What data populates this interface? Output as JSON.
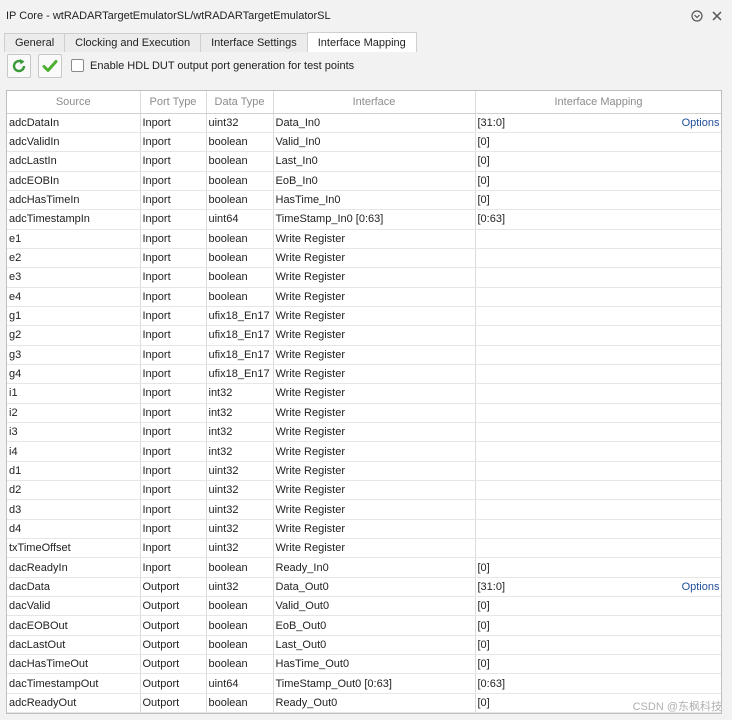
{
  "window": {
    "title": "IP Core - wtRADARTargetEmulatorSL/wtRADARTargetEmulatorSL"
  },
  "tabs": [
    {
      "label": "General"
    },
    {
      "label": "Clocking and Execution"
    },
    {
      "label": "Interface Settings"
    },
    {
      "label": "Interface Mapping"
    }
  ],
  "active_tab": "Interface Mapping",
  "toolbar": {
    "checkbox_label": "Enable HDL DUT output port generation for test points"
  },
  "table": {
    "columns": [
      "Source",
      "Port Type",
      "Data Type",
      "Interface",
      "Interface Mapping"
    ],
    "rows": [
      {
        "source": "adcDataIn",
        "port": "Inport",
        "dtype": "uint32",
        "iface": "Data_In0",
        "mapping": "[31:0]",
        "options": "Options"
      },
      {
        "source": "adcValidIn",
        "port": "Inport",
        "dtype": "boolean",
        "iface": "Valid_In0",
        "mapping": "[0]",
        "options": ""
      },
      {
        "source": "adcLastIn",
        "port": "Inport",
        "dtype": "boolean",
        "iface": "Last_In0",
        "mapping": "[0]",
        "options": ""
      },
      {
        "source": "adcEOBIn",
        "port": "Inport",
        "dtype": "boolean",
        "iface": "EoB_In0",
        "mapping": "[0]",
        "options": ""
      },
      {
        "source": "adcHasTimeIn",
        "port": "Inport",
        "dtype": "boolean",
        "iface": "HasTime_In0",
        "mapping": "[0]",
        "options": ""
      },
      {
        "source": "adcTimestampIn",
        "port": "Inport",
        "dtype": "uint64",
        "iface": "TimeStamp_In0 [0:63]",
        "mapping": "[0:63]",
        "options": ""
      },
      {
        "source": "e1",
        "port": "Inport",
        "dtype": "boolean",
        "iface": "Write Register",
        "mapping": "",
        "options": ""
      },
      {
        "source": "e2",
        "port": "Inport",
        "dtype": "boolean",
        "iface": "Write Register",
        "mapping": "",
        "options": ""
      },
      {
        "source": "e3",
        "port": "Inport",
        "dtype": "boolean",
        "iface": "Write Register",
        "mapping": "",
        "options": ""
      },
      {
        "source": "e4",
        "port": "Inport",
        "dtype": "boolean",
        "iface": "Write Register",
        "mapping": "",
        "options": ""
      },
      {
        "source": "g1",
        "port": "Inport",
        "dtype": "ufix18_En17",
        "iface": "Write Register",
        "mapping": "",
        "options": ""
      },
      {
        "source": "g2",
        "port": "Inport",
        "dtype": "ufix18_En17",
        "iface": "Write Register",
        "mapping": "",
        "options": ""
      },
      {
        "source": "g3",
        "port": "Inport",
        "dtype": "ufix18_En17",
        "iface": "Write Register",
        "mapping": "",
        "options": ""
      },
      {
        "source": "g4",
        "port": "Inport",
        "dtype": "ufix18_En17",
        "iface": "Write Register",
        "mapping": "",
        "options": ""
      },
      {
        "source": "i1",
        "port": "Inport",
        "dtype": "int32",
        "iface": "Write Register",
        "mapping": "",
        "options": ""
      },
      {
        "source": "i2",
        "port": "Inport",
        "dtype": "int32",
        "iface": "Write Register",
        "mapping": "",
        "options": ""
      },
      {
        "source": "i3",
        "port": "Inport",
        "dtype": "int32",
        "iface": "Write Register",
        "mapping": "",
        "options": ""
      },
      {
        "source": "i4",
        "port": "Inport",
        "dtype": "int32",
        "iface": "Write Register",
        "mapping": "",
        "options": ""
      },
      {
        "source": "d1",
        "port": "Inport",
        "dtype": "uint32",
        "iface": "Write Register",
        "mapping": "",
        "options": ""
      },
      {
        "source": "d2",
        "port": "Inport",
        "dtype": "uint32",
        "iface": "Write Register",
        "mapping": "",
        "options": ""
      },
      {
        "source": "d3",
        "port": "Inport",
        "dtype": "uint32",
        "iface": "Write Register",
        "mapping": "",
        "options": ""
      },
      {
        "source": "d4",
        "port": "Inport",
        "dtype": "uint32",
        "iface": "Write Register",
        "mapping": "",
        "options": ""
      },
      {
        "source": "txTimeOffset",
        "port": "Inport",
        "dtype": "uint32",
        "iface": "Write Register",
        "mapping": "",
        "options": ""
      },
      {
        "source": "dacReadyIn",
        "port": "Inport",
        "dtype": "boolean",
        "iface": "Ready_In0",
        "mapping": "[0]",
        "options": ""
      },
      {
        "source": "dacData",
        "port": "Outport",
        "dtype": "uint32",
        "iface": "Data_Out0",
        "mapping": "[31:0]",
        "options": "Options"
      },
      {
        "source": "dacValid",
        "port": "Outport",
        "dtype": "boolean",
        "iface": "Valid_Out0",
        "mapping": "[0]",
        "options": ""
      },
      {
        "source": "dacEOBOut",
        "port": "Outport",
        "dtype": "boolean",
        "iface": "EoB_Out0",
        "mapping": "[0]",
        "options": ""
      },
      {
        "source": "dacLastOut",
        "port": "Outport",
        "dtype": "boolean",
        "iface": "Last_Out0",
        "mapping": "[0]",
        "options": ""
      },
      {
        "source": "dacHasTimeOut",
        "port": "Outport",
        "dtype": "boolean",
        "iface": "HasTime_Out0",
        "mapping": "[0]",
        "options": ""
      },
      {
        "source": "dacTimestampOut",
        "port": "Outport",
        "dtype": "uint64",
        "iface": "TimeStamp_Out0 [0:63]",
        "mapping": "[0:63]",
        "options": ""
      },
      {
        "source": "adcReadyOut",
        "port": "Outport",
        "dtype": "boolean",
        "iface": "Ready_Out0",
        "mapping": "[0]",
        "options": ""
      }
    ]
  },
  "watermark": "CSDN @东枫科技",
  "colors": {
    "link": "#1f4e9a",
    "refresh_icon": "#3a9a3a",
    "apply_icon": "#4caf2f"
  }
}
